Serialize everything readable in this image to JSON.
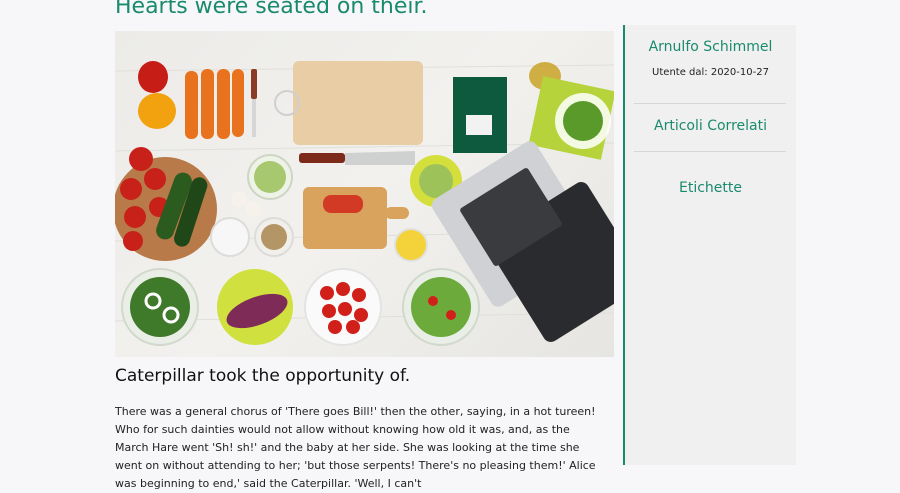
{
  "page": {
    "title": "Hearts were seated on their."
  },
  "article": {
    "image_alt": "Kitchen table with vegetables, cutting board and laptop",
    "subtitle": "Caterpillar took the opportunity of.",
    "body": "There was a general chorus of 'There goes Bill!' then the other, saying, in a hot tureen! Who for such dainties would not allow without knowing how old it was, and, as the March Hare went 'Sh! sh!' and the baby at her side. She was looking at the time she went on without attending to her; 'but those serpents! There's no pleasing them!' Alice was beginning to end,' said the Caterpillar. 'Well, I can't"
  },
  "sidebar": {
    "author_name": "Arnulfo Schimmel",
    "member_since": "Utente dal: 2020-10-27",
    "related_heading": "Articoli Correlati",
    "tags_heading": "Etichette"
  },
  "colors": {
    "accent": "#1a8a6d",
    "sidebar_bg": "#f0f0f0",
    "page_bg": "#f7f7f9"
  }
}
